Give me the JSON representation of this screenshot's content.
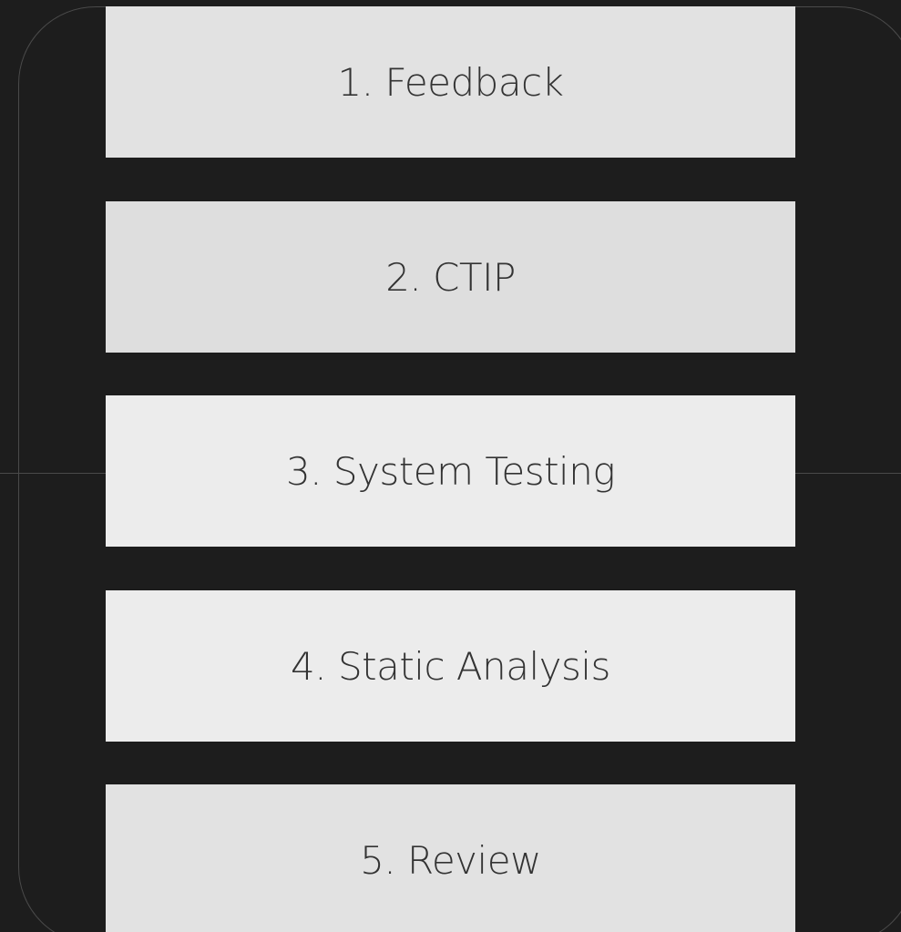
{
  "steps": [
    {
      "label": "1. Feedback",
      "fill": "#e2e2e2"
    },
    {
      "label": "2. CTIP",
      "fill": "#dedede"
    },
    {
      "label": "3. System Testing",
      "fill": "#ececec"
    },
    {
      "label": "4. Static Analysis",
      "fill": "#ececec"
    },
    {
      "label": "5. Review",
      "fill": "#e2e2e2"
    }
  ],
  "colors": {
    "background": "#1d1d1d",
    "outline": "#4a4a4a",
    "text": "#333333"
  }
}
